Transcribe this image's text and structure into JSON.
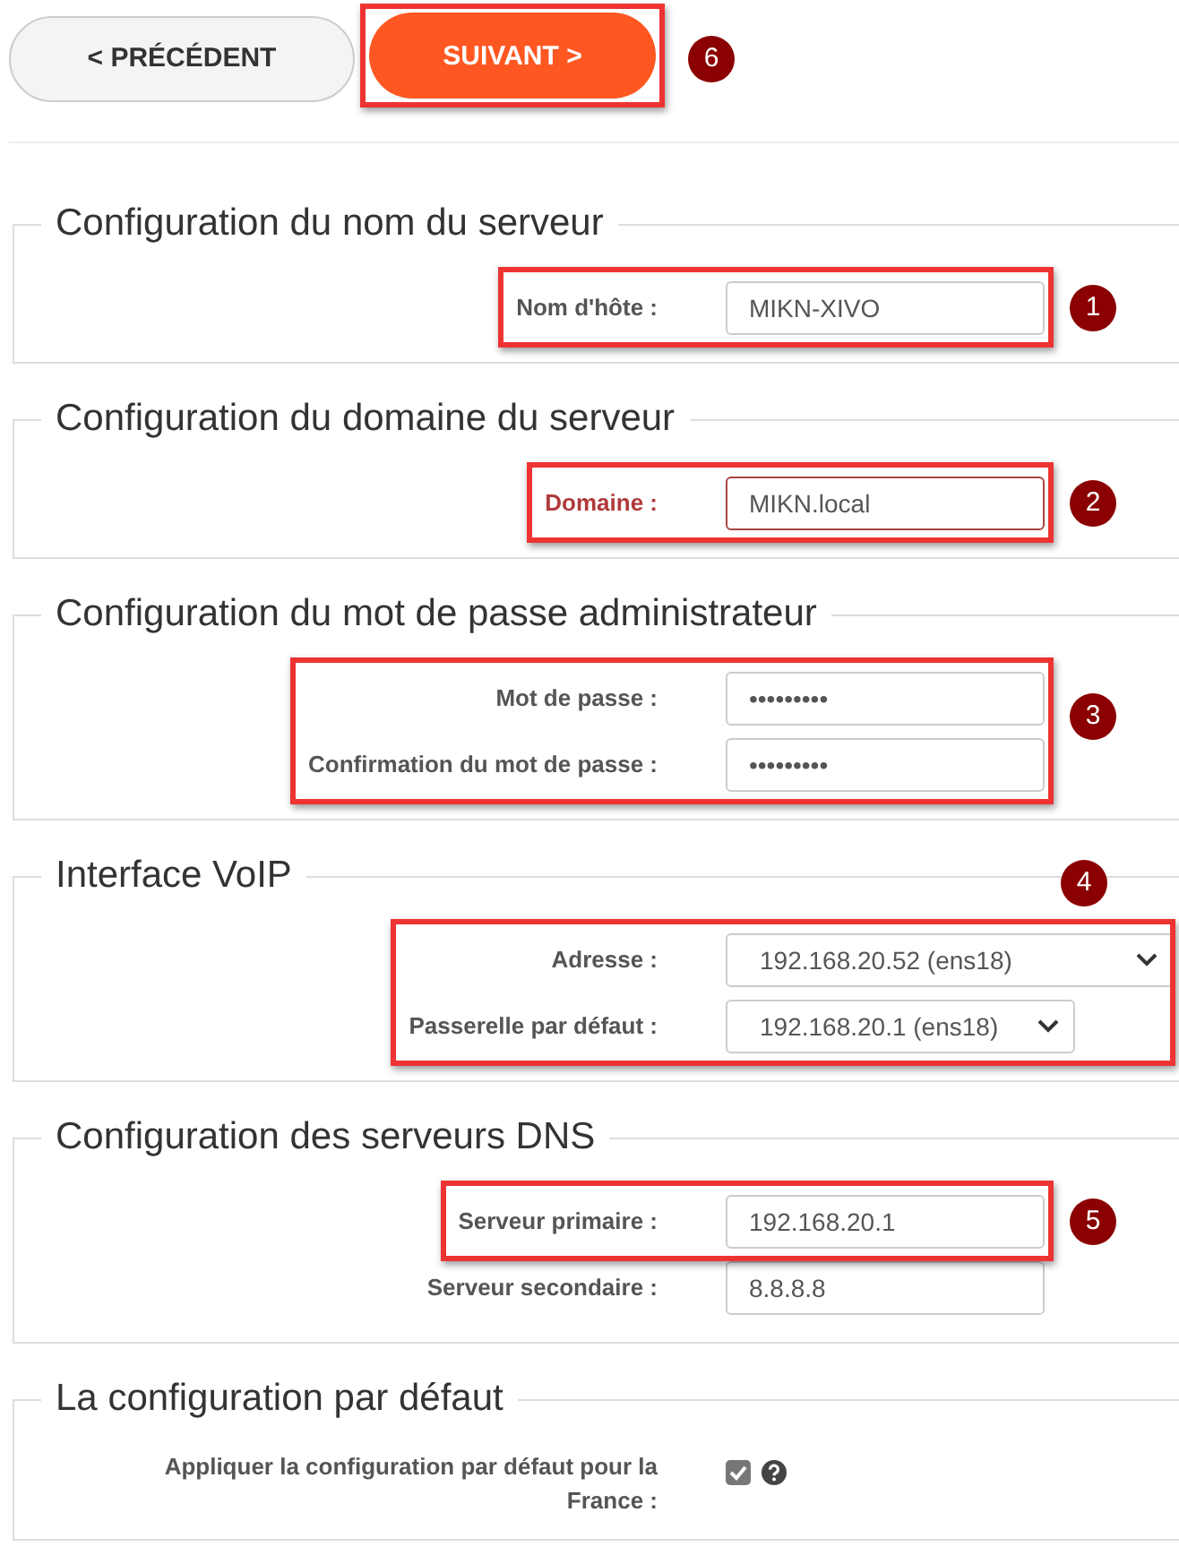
{
  "nav": {
    "buttons": [
      {
        "label": "< PRÉCÉDENT",
        "kind": "secondary"
      },
      {
        "label": "SUIVANT >",
        "kind": "primary",
        "annotation": "6"
      }
    ]
  },
  "sections": [
    {
      "title": "Configuration du nom du serveur",
      "annotation": "1",
      "fields": [
        {
          "label": "Nom d'hôte :",
          "kind": "text",
          "value": "MIKN-XIVO",
          "error": false,
          "annotated": true
        }
      ]
    },
    {
      "title": "Configuration du domaine du serveur",
      "annotation": "2",
      "fields": [
        {
          "label": "Domaine :",
          "kind": "text",
          "value": "MIKN.local",
          "error": true,
          "annotated": true
        }
      ]
    },
    {
      "title": "Configuration du mot de passe administrateur",
      "annotation": "3",
      "fields": [
        {
          "label": "Mot de passe :",
          "kind": "password",
          "value": "•••••••••",
          "error": false,
          "annotated": true
        },
        {
          "label": "Confirmation du mot de passe :",
          "kind": "password",
          "value": "•••••••••",
          "error": false,
          "annotated": true
        }
      ]
    },
    {
      "title": "Interface VoIP",
      "annotation": "4",
      "fields": [
        {
          "label": "Adresse :",
          "kind": "select",
          "value": "192.168.20.52 (ens18)",
          "error": false,
          "annotated": true
        },
        {
          "label": "Passerelle par défaut :",
          "kind": "select",
          "value": "192.168.20.1 (ens18)",
          "error": false,
          "annotated": true
        }
      ]
    },
    {
      "title": "Configuration des serveurs DNS",
      "annotation": "5",
      "fields": [
        {
          "label": "Serveur primaire :",
          "kind": "text",
          "value": "192.168.20.1",
          "error": false,
          "annotated": true
        },
        {
          "label": "Serveur secondaire :",
          "kind": "text",
          "value": "8.8.8.8",
          "error": false
        }
      ]
    },
    {
      "title": "La configuration par défaut",
      "fields": [
        {
          "label": "Appliquer la configuration par défaut pour la France :",
          "kind": "checkbox",
          "checked": true,
          "help": true,
          "error": false
        }
      ]
    }
  ]
}
